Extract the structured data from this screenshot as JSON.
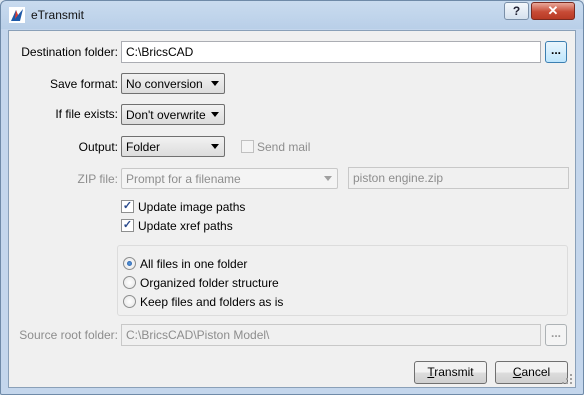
{
  "window": {
    "title": "eTransmit"
  },
  "titlebar": {
    "help_glyph": "?",
    "close_glyph": "✕"
  },
  "form": {
    "destination": {
      "label": "Destination folder:",
      "value": "C:\\BricsCAD",
      "browse_label": "..."
    },
    "save_format": {
      "label": "Save format:",
      "value": "No conversion"
    },
    "if_exists": {
      "label": "If file exists:",
      "value": "Don't overwrite"
    },
    "output": {
      "label": "Output:",
      "value": "Folder"
    },
    "send_mail": {
      "label": "Send mail",
      "checked": false,
      "enabled": false
    },
    "zip": {
      "label": "ZIP file:",
      "value": "Prompt for a filename",
      "filename": "piston engine.zip"
    },
    "update_image_paths": {
      "label": "Update image paths",
      "checked": true
    },
    "update_xref_paths": {
      "label": "Update xref paths",
      "checked": true
    },
    "structure_options": [
      {
        "label": "All files in one folder",
        "selected": true
      },
      {
        "label": "Organized folder structure",
        "selected": false
      },
      {
        "label": "Keep files and folders as is",
        "selected": false
      }
    ],
    "source_root": {
      "label": "Source root folder:",
      "value": "C:\\BricsCAD\\Piston Model\\",
      "browse_label": "..."
    }
  },
  "buttons": {
    "transmit": {
      "mnemonic": "T",
      "rest": "ransmit"
    },
    "cancel": {
      "mnemonic": "C",
      "rest": "ancel"
    }
  },
  "icons": {
    "app": "bricscad-logo-icon",
    "help": "help-icon",
    "close": "close-icon",
    "grip": "resize-grip-icon"
  },
  "colors": {
    "accent": "#3c7fb1",
    "close_red": "#c74b36"
  }
}
